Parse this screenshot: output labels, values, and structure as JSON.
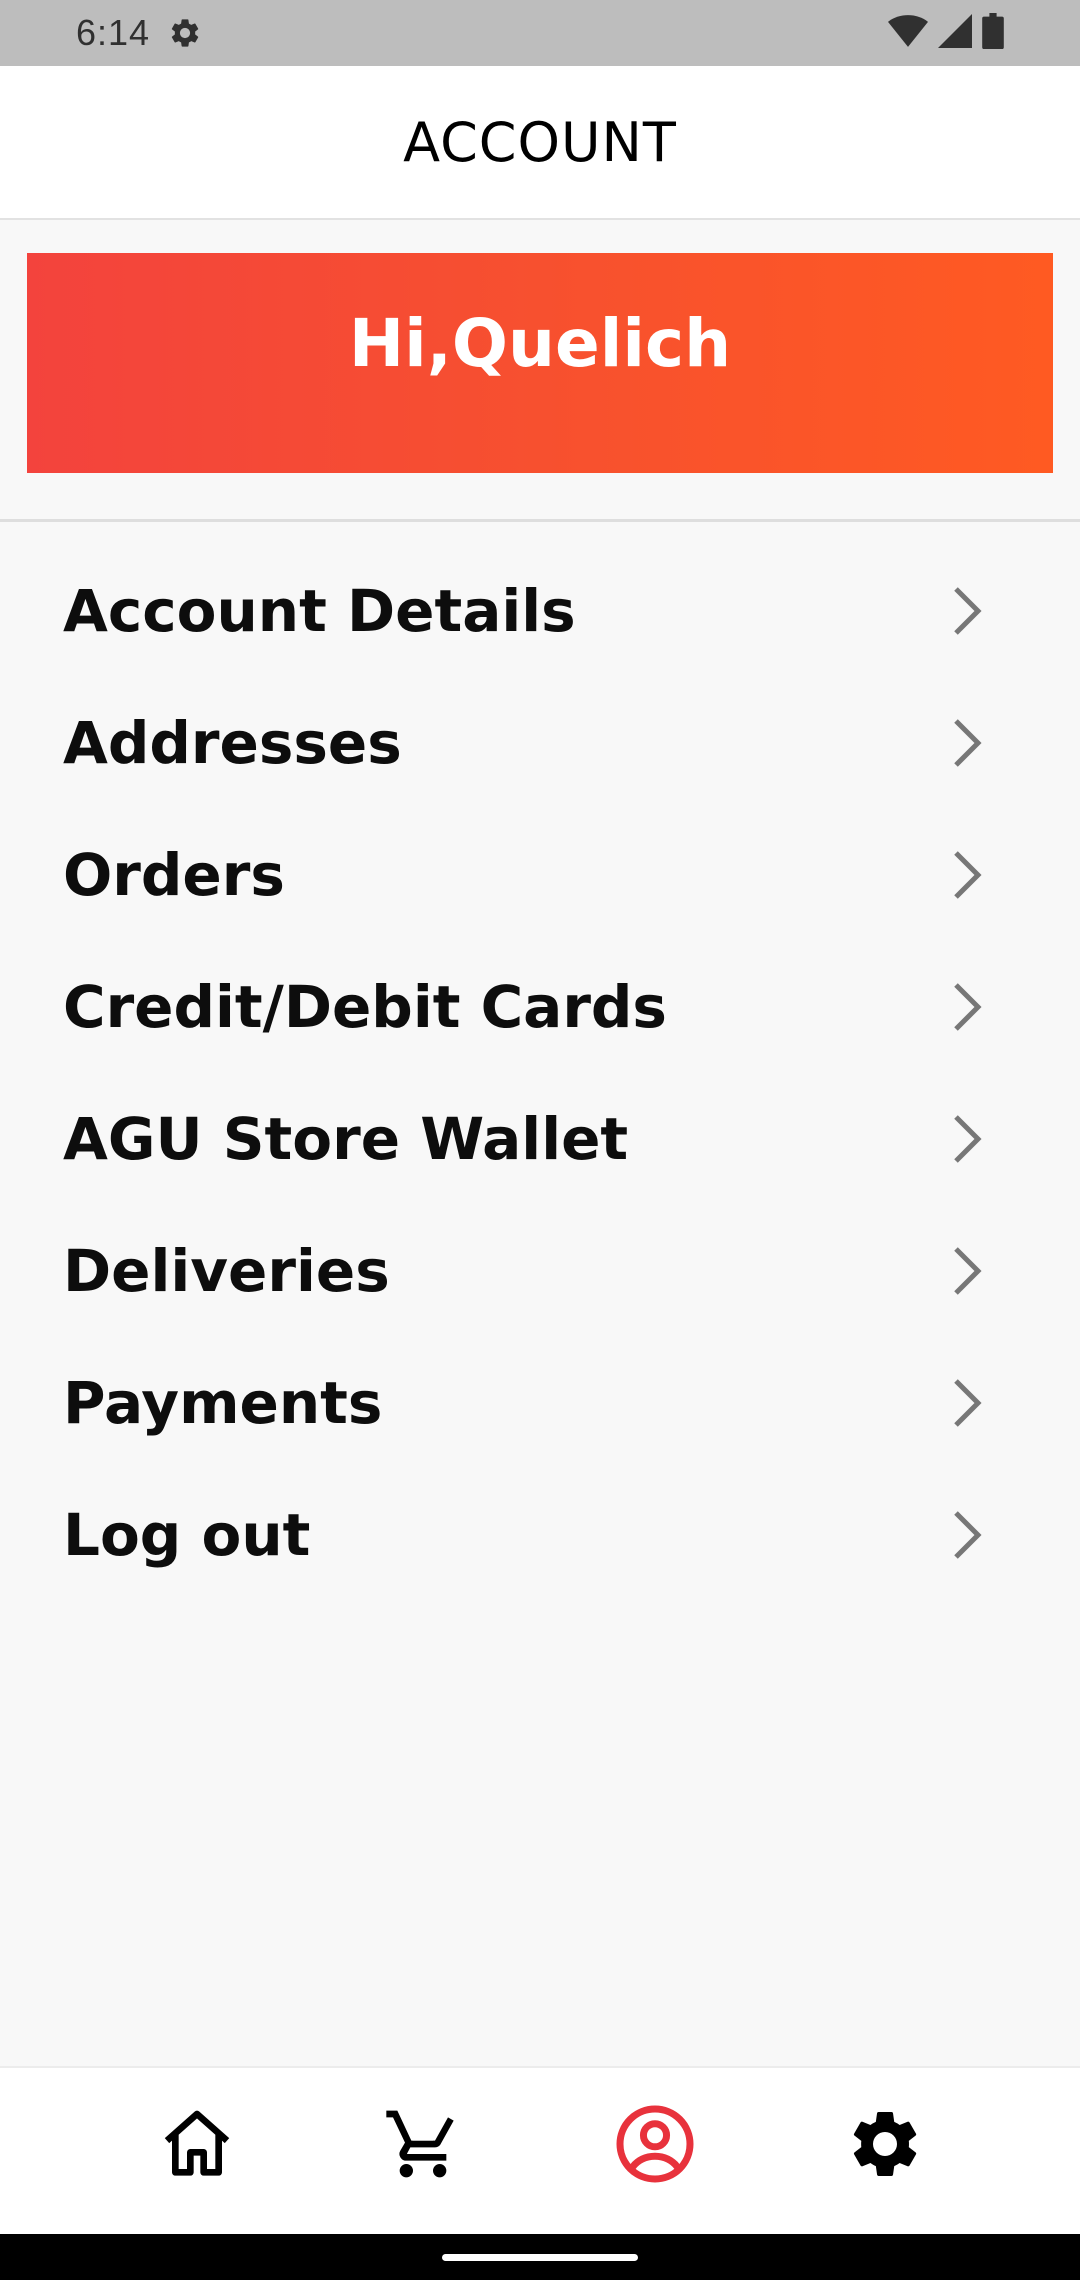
{
  "status_bar": {
    "time": "6:14",
    "icons": [
      "settings-icon",
      "wifi-icon",
      "signal-icon",
      "battery-icon"
    ]
  },
  "app_bar": {
    "title": "ACCOUNT"
  },
  "greeting": {
    "text": "Hi,Quelich",
    "gradient_start": "#f3433d",
    "gradient_end": "#ff5a22"
  },
  "menu": {
    "items": [
      {
        "label": "Account Details"
      },
      {
        "label": "Addresses"
      },
      {
        "label": "Orders"
      },
      {
        "label": "Credit/Debit Cards"
      },
      {
        "label": "AGU Store Wallet"
      },
      {
        "label": "Deliveries"
      },
      {
        "label": "Payments"
      },
      {
        "label": "Log out"
      }
    ],
    "chevron_icon": "chevron-right-icon"
  },
  "bottom_nav": {
    "items": [
      {
        "icon": "home-icon",
        "active": false
      },
      {
        "icon": "cart-icon",
        "active": false
      },
      {
        "icon": "account-icon",
        "active": true
      },
      {
        "icon": "settings-icon",
        "active": false
      }
    ],
    "active_color": "#e8323c",
    "inactive_color": "#000000"
  }
}
